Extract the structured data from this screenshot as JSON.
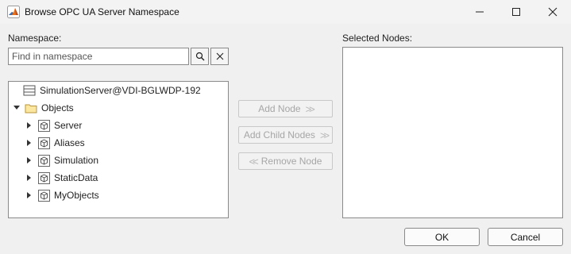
{
  "window": {
    "title": "Browse OPC UA Server Namespace",
    "icon": "matlab-logo-icon"
  },
  "namespace": {
    "label": "Namespace:",
    "search_placeholder": "Find in namespace",
    "search_icon": "search-icon",
    "clear_icon": "close-icon",
    "tree": {
      "server": "SimulationServer@VDI-BGLWDP-192",
      "root": "Objects",
      "children": [
        "Server",
        "Aliases",
        "Simulation",
        "StaticData",
        "MyObjects"
      ]
    }
  },
  "actions": {
    "add_node": "Add Node",
    "add_child_nodes": "Add Child Nodes",
    "remove_node": "Remove Node",
    "enabled": false
  },
  "selected": {
    "label": "Selected Nodes:"
  },
  "footer": {
    "ok": "OK",
    "cancel": "Cancel"
  }
}
